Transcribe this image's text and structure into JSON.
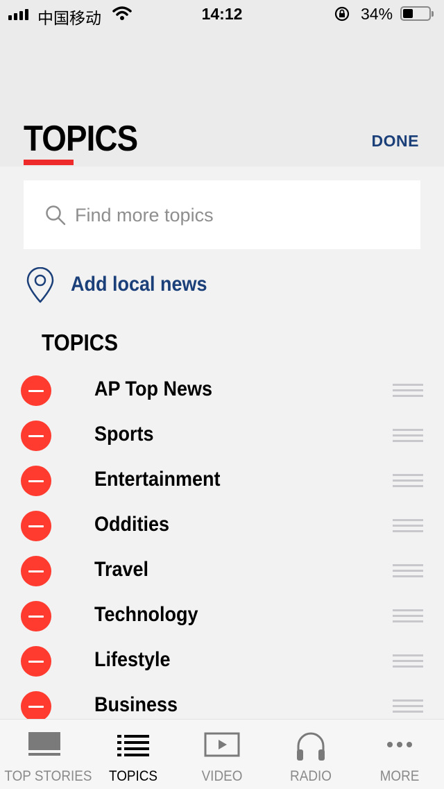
{
  "status_bar": {
    "carrier": "中国移动",
    "time": "14:12",
    "battery": "34%"
  },
  "header": {
    "title": "TOPICS",
    "done": "DONE"
  },
  "search": {
    "placeholder": "Find more topics",
    "icon": "search-icon"
  },
  "local": {
    "label": "Add local news",
    "icon": "location-pin-icon"
  },
  "section": {
    "heading": "TOPICS"
  },
  "topics": [
    {
      "label": "AP Top News"
    },
    {
      "label": "Sports"
    },
    {
      "label": "Entertainment"
    },
    {
      "label": "Oddities"
    },
    {
      "label": "Travel"
    },
    {
      "label": "Technology"
    },
    {
      "label": "Lifestyle"
    },
    {
      "label": "Business"
    }
  ],
  "tabbar": {
    "tabs": [
      {
        "label": "TOP STORIES",
        "icon": "top-stories-icon"
      },
      {
        "label": "TOPICS",
        "icon": "topics-list-icon",
        "active": true
      },
      {
        "label": "VIDEO",
        "icon": "video-icon"
      },
      {
        "label": "RADIO",
        "icon": "headphones-icon"
      },
      {
        "label": "MORE",
        "icon": "more-icon"
      }
    ]
  },
  "colors": {
    "accent_red": "#ff3b30",
    "brand_blue": "#1b3f79",
    "underline_red": "#ee2a2a"
  }
}
